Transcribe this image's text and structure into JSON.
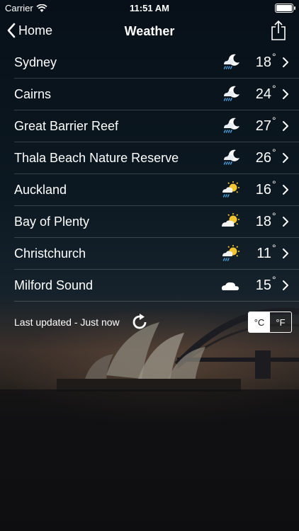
{
  "status": {
    "carrier": "Carrier",
    "time": "11:51 AM",
    "battery_level": 1.0
  },
  "nav": {
    "back_label": "Home",
    "title": "Weather"
  },
  "locations": [
    {
      "name": "Sydney",
      "temp": "18",
      "icon": "night-rain-icon"
    },
    {
      "name": "Cairns",
      "temp": "24",
      "icon": "night-rain-icon"
    },
    {
      "name": "Great Barrier Reef",
      "temp": "27",
      "icon": "night-rain-icon"
    },
    {
      "name": "Thala Beach Nature Reserve",
      "temp": "26",
      "icon": "night-rain-icon"
    },
    {
      "name": "Auckland",
      "temp": "16",
      "icon": "sun-rain-icon"
    },
    {
      "name": "Bay of Plenty",
      "temp": "18",
      "icon": "sun-cloud-icon"
    },
    {
      "name": "Christchurch",
      "temp": "11",
      "icon": "sun-rain-icon"
    },
    {
      "name": "Milford Sound",
      "temp": "15",
      "icon": "cloud-icon"
    }
  ],
  "degree_symbol": "°",
  "footer": {
    "updated_text": "Last updated - Just now",
    "unit_celsius": "°C",
    "unit_fahrenheit": "°F",
    "selected_unit": "celsius"
  }
}
